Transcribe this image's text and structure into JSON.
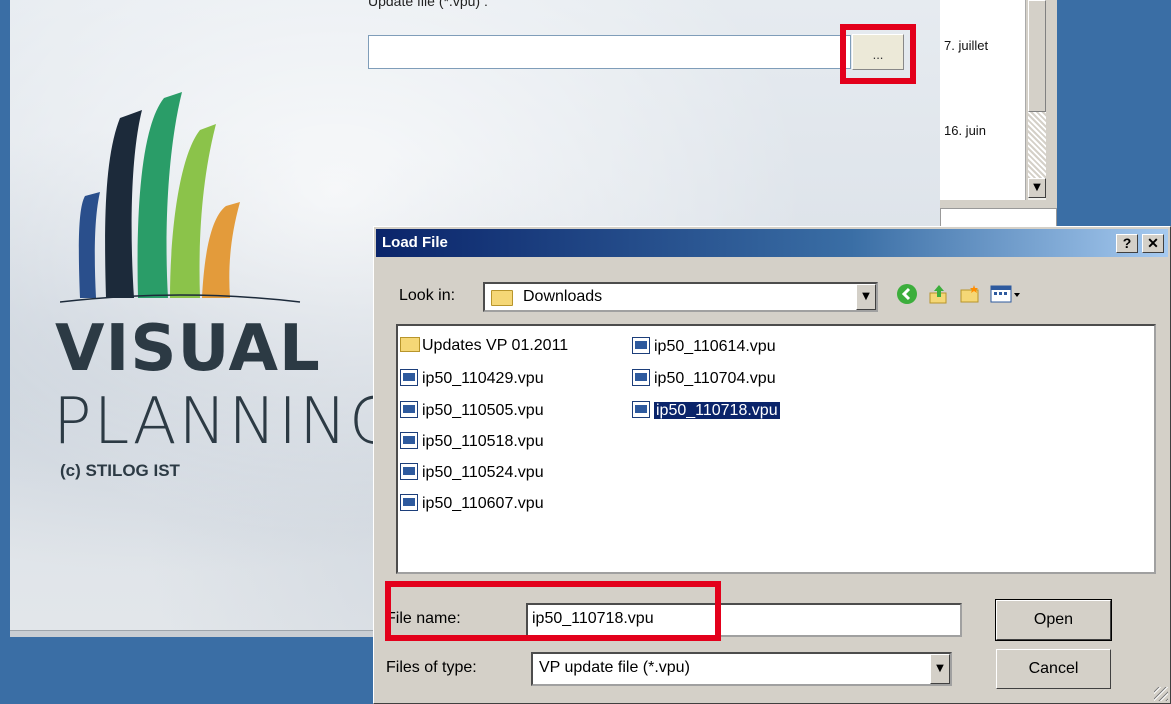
{
  "splash": {
    "brand_line1": "VISUAL",
    "brand_line2": "PLANNING",
    "copyright": "(c) STILOG IST",
    "update_label": "Update file (*.vpu) :",
    "browse_button": "...",
    "logo_colors": [
      "#2a4f8c",
      "#1c2a3a",
      "#2a9d68",
      "#8bc34a",
      "#e39b3b"
    ]
  },
  "side_list": {
    "items": [
      "7. juillet",
      "16. juin"
    ]
  },
  "dialog": {
    "title": "Load File",
    "help_button": "?",
    "close_button": "✕",
    "look_in_label": "Look in:",
    "look_in_value": "Downloads",
    "toolbar_icons": [
      "back-icon",
      "up-folder-icon",
      "new-folder-icon",
      "view-menu-icon"
    ],
    "files_col1": [
      {
        "name": "Updates VP 01.2011",
        "type": "folder"
      },
      {
        "name": "ip50_110429.vpu",
        "type": "file"
      },
      {
        "name": "ip50_110505.vpu",
        "type": "file"
      },
      {
        "name": "ip50_110518.vpu",
        "type": "file"
      },
      {
        "name": "ip50_110524.vpu",
        "type": "file"
      },
      {
        "name": "ip50_110607.vpu",
        "type": "file"
      }
    ],
    "files_col2": [
      {
        "name": "ip50_110614.vpu",
        "type": "file"
      },
      {
        "name": "ip50_110704.vpu",
        "type": "file"
      },
      {
        "name": "ip50_110718.vpu",
        "type": "file",
        "selected": true
      }
    ],
    "file_name_label": "File name:",
    "file_name_value": "ip50_110718.vpu",
    "file_type_label": "Files of type:",
    "file_type_value": "VP update file (*.vpu)",
    "open_button": "Open",
    "cancel_button": "Cancel"
  },
  "highlight_color": "#e3001b"
}
